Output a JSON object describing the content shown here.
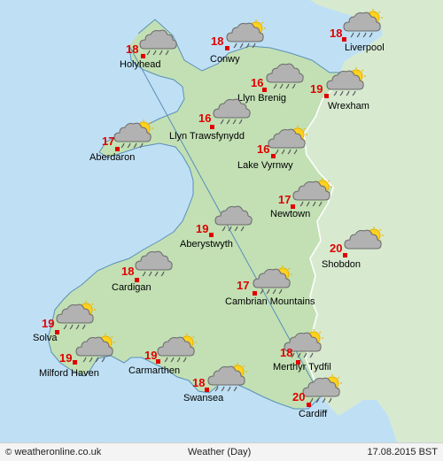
{
  "map": {
    "colors": {
      "sea": "#bfe0f4",
      "wales": "#c2e0b4",
      "england": "#d7ead0",
      "border": "#ffffff",
      "coast": "#5a8fb8",
      "marker": "#e00000",
      "temp": "#e00000"
    },
    "locations": [
      {
        "name": "Holyhead",
        "temp": "18",
        "icon": "cloud-rain"
      },
      {
        "name": "Conwy",
        "temp": "18",
        "icon": "cloud-rain-sun"
      },
      {
        "name": "Liverpool",
        "temp": "18",
        "icon": "cloud-sun-rain"
      },
      {
        "name": "Llyn Brenig",
        "temp": "16",
        "icon": "cloud-rain"
      },
      {
        "name": "Wrexham",
        "temp": "19",
        "icon": "cloud-sun-rain"
      },
      {
        "name": "Llyn Trawsfynydd",
        "temp": "16",
        "icon": "cloud-rain"
      },
      {
        "name": "Aberdaron",
        "temp": "17",
        "icon": "cloud-rain-sun"
      },
      {
        "name": "Lake Vyrnwy",
        "temp": "16",
        "icon": "cloud-rain-sun"
      },
      {
        "name": "Newtown",
        "temp": "17",
        "icon": "cloud-sun-rain"
      },
      {
        "name": "Aberystwyth",
        "temp": "19",
        "icon": "cloud-rain"
      },
      {
        "name": "Shobdon",
        "temp": "20",
        "icon": "cloud-sun"
      },
      {
        "name": "Cardigan",
        "temp": "18",
        "icon": "cloud-rain"
      },
      {
        "name": "Cambrian Mountains",
        "temp": "17",
        "icon": "cloud-sun-rain"
      },
      {
        "name": "Solva",
        "temp": "19",
        "icon": "cloud-rain-sun"
      },
      {
        "name": "Milford Haven",
        "temp": "19",
        "icon": "cloud-rain-sun"
      },
      {
        "name": "Carmarthen",
        "temp": "19",
        "icon": "cloud-sun-rain"
      },
      {
        "name": "Merthyr Tydfil",
        "temp": "18",
        "icon": "cloud-sun-rain"
      },
      {
        "name": "Swansea",
        "temp": "18",
        "icon": "cloud-sun-rain"
      },
      {
        "name": "Cardiff",
        "temp": "20",
        "icon": "cloud-sun-rain"
      }
    ]
  },
  "footer": {
    "credit_icon": "©",
    "credit": "weatheronline.co.uk",
    "title": "Weather (Day)",
    "date": "17.08.2015 BST"
  }
}
